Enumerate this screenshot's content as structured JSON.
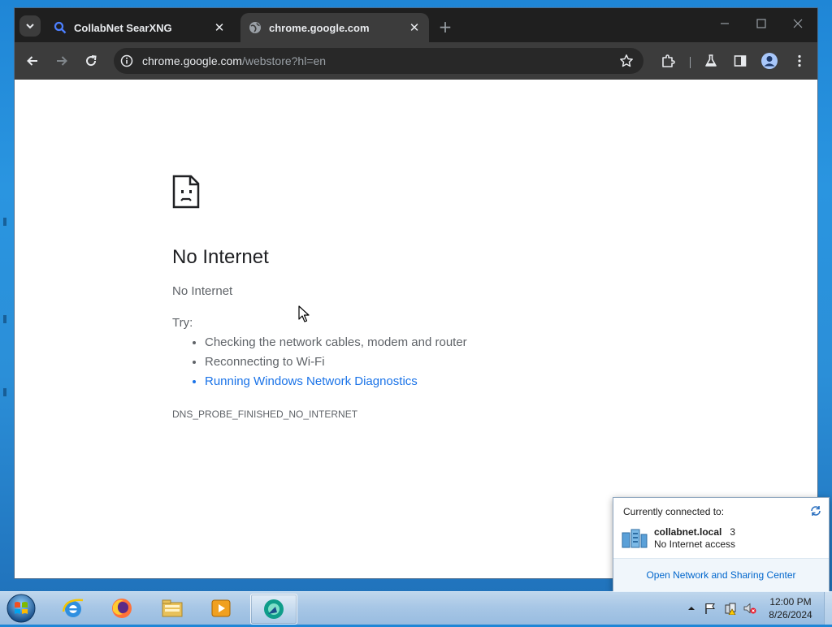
{
  "browser": {
    "tabs": [
      {
        "title": "CollabNet SearXNG",
        "icon": "search-icon",
        "active": false
      },
      {
        "title": "chrome.google.com",
        "icon": "globe-icon",
        "active": true
      }
    ],
    "new_tab_label": "+",
    "url_host": "chrome.google.com",
    "url_rest": "/webstore?hl=en"
  },
  "error_page": {
    "title": "No Internet",
    "subtitle": "No Internet",
    "try_label": "Try:",
    "suggestions": [
      "Checking the network cables, modem and router",
      "Reconnecting to Wi-Fi",
      "Running Windows Network Diagnostics"
    ],
    "error_code": "DNS_PROBE_FINISHED_NO_INTERNET"
  },
  "network_flyout": {
    "header": "Currently connected to:",
    "network_name": "collabnet.local",
    "network_number": "3",
    "status": "No Internet access",
    "footer_link": "Open Network and Sharing Center"
  },
  "taskbar": {
    "apps": [
      "internet-explorer-icon",
      "firefox-icon",
      "file-explorer-icon",
      "media-player-icon",
      "chrome-app-icon"
    ],
    "time": "12:00 PM",
    "date": "8/26/2024"
  },
  "colors": {
    "link": "#1a73e8",
    "tabstrip": "#1f1f1f",
    "toolbar": "#3c3c3c"
  }
}
